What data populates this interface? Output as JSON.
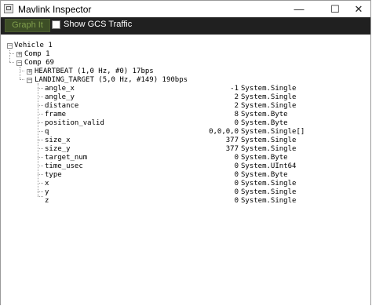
{
  "window": {
    "title": "Mavlink Inspector",
    "minimize_glyph": "—",
    "maximize_glyph": "☐",
    "close_glyph": "✕"
  },
  "toolbar": {
    "graph_button_label": "Graph It",
    "show_gcs_traffic_label": "Show GCS Traffic",
    "show_gcs_traffic_checked": false
  },
  "tree": {
    "vehicle": {
      "label": "Vehicle 1",
      "expander": "−"
    },
    "comp1": {
      "label": "Comp 1",
      "expander": "+"
    },
    "comp69": {
      "label": "Comp 69",
      "expander": "−"
    },
    "heartbeat": {
      "label": "HEARTBEAT (1,0 Hz, #0) 17bps",
      "expander": "+"
    },
    "landing_target": {
      "label": "LANDING_TARGET (5,0 Hz, #149) 190bps",
      "expander": "−"
    },
    "fields": [
      {
        "name": "angle_x",
        "value": "-1",
        "type": "System.Single"
      },
      {
        "name": "angle_y",
        "value": "2",
        "type": "System.Single"
      },
      {
        "name": "distance",
        "value": "2",
        "type": "System.Single"
      },
      {
        "name": "frame",
        "value": "8",
        "type": "System.Byte"
      },
      {
        "name": "position_valid",
        "value": "0",
        "type": "System.Byte"
      },
      {
        "name": "q",
        "value": "0,0,0,0",
        "type": "System.Single[]"
      },
      {
        "name": "size_x",
        "value": "377",
        "type": "System.Single"
      },
      {
        "name": "size_y",
        "value": "377",
        "type": "System.Single"
      },
      {
        "name": "target_num",
        "value": "0",
        "type": "System.Byte"
      },
      {
        "name": "time_usec",
        "value": "0",
        "type": "System.UInt64"
      },
      {
        "name": "type",
        "value": "0",
        "type": "System.Byte"
      },
      {
        "name": "x",
        "value": "0",
        "type": "System.Single"
      },
      {
        "name": "y",
        "value": "0",
        "type": "System.Single"
      },
      {
        "name": "z",
        "value": "0",
        "type": "System.Single"
      }
    ]
  },
  "colors": {
    "toolbar_bg": "#202020",
    "graph_button_bg": "#3d4e26",
    "graph_button_text": "#7f9e4c"
  }
}
